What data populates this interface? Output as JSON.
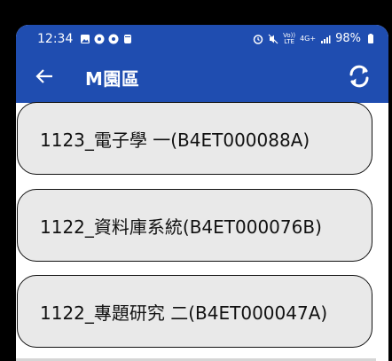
{
  "status_bar": {
    "time": "12:34",
    "left_icons": [
      "image-icon",
      "sun-icon",
      "sun-icon",
      "jar-icon"
    ],
    "right_text": {
      "volte": "Vo))",
      "lte": "LTE",
      "network": "4G+",
      "battery": "98%"
    },
    "right_icons": [
      "alarm-icon",
      "mute-icon",
      "signal-icon",
      "battery-icon"
    ]
  },
  "app_bar": {
    "title": "M園區",
    "back_icon": "arrow-left-icon",
    "refresh_icon": "sync-icon",
    "background": "#1f4db0"
  },
  "courses": [
    {
      "label": "1123_電子學 一(B4ET000088A)"
    },
    {
      "label": "1122_資料庫系統(B4ET000076B)"
    },
    {
      "label": "1122_專題研究 二(B4ET000047A)"
    }
  ]
}
